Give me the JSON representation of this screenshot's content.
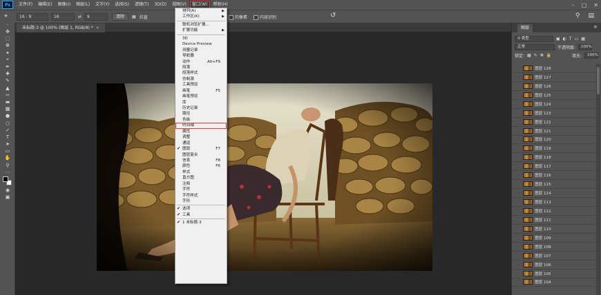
{
  "app": {
    "logo": "Ps"
  },
  "menubar": {
    "items": [
      {
        "label": "文件(F)"
      },
      {
        "label": "编辑(E)"
      },
      {
        "label": "图像(I)"
      },
      {
        "label": "图层(L)"
      },
      {
        "label": "文字(Y)"
      },
      {
        "label": "选择(S)"
      },
      {
        "label": "滤镜(T)"
      },
      {
        "label": "3D(D)"
      },
      {
        "label": "视图(V)"
      },
      {
        "label": "窗口(W)"
      },
      {
        "label": "帮助(H)"
      }
    ],
    "active_index": 9,
    "window_controls": [
      "minimize-icon",
      "restore-icon",
      "close-icon"
    ]
  },
  "options": {
    "ratio_value": "16 : 9",
    "width_value": "16",
    "height_value": "9",
    "clear_label": "清除",
    "straighten_label": "拉直",
    "delete_pixels_label": "的像素",
    "content_aware_label": "内容识别"
  },
  "document": {
    "tab_title": "未标题-3 @ 100% (图层 1, RGB/8) *"
  },
  "window_menu": {
    "items": [
      {
        "label": "排列(A)",
        "submenu": true
      },
      {
        "label": "工作区(K)",
        "submenu": true
      },
      {
        "sep": true
      },
      {
        "label": "联机浏览扩展..."
      },
      {
        "label": "扩展功能",
        "submenu": true
      },
      {
        "sep": true
      },
      {
        "label": "3D"
      },
      {
        "label": "Device Preview"
      },
      {
        "label": "测量记录"
      },
      {
        "label": "导航器"
      },
      {
        "label": "动作",
        "shortcut": "Alt+F9"
      },
      {
        "label": "段落"
      },
      {
        "label": "段落样式"
      },
      {
        "label": "仿制源"
      },
      {
        "label": "工具预设"
      },
      {
        "label": "画笔",
        "shortcut": "F5"
      },
      {
        "label": "画笔预设"
      },
      {
        "label": "库"
      },
      {
        "label": "历史记录"
      },
      {
        "label": "路径"
      },
      {
        "label": "色板"
      },
      {
        "label": "时间轴",
        "highlight": true
      },
      {
        "label": "属性"
      },
      {
        "label": "调整"
      },
      {
        "label": "通道"
      },
      {
        "label": "图层",
        "shortcut": "F7",
        "checked": true
      },
      {
        "label": "图层复合"
      },
      {
        "label": "信息",
        "shortcut": "F8"
      },
      {
        "label": "颜色",
        "shortcut": "F6"
      },
      {
        "label": "样式"
      },
      {
        "label": "直方图"
      },
      {
        "label": "注释"
      },
      {
        "label": "字符"
      },
      {
        "label": "字符样式"
      },
      {
        "label": "字形"
      },
      {
        "sep": true
      },
      {
        "label": "选项",
        "checked": true
      },
      {
        "label": "工具",
        "checked": true
      },
      {
        "sep": true
      },
      {
        "label": "1 未标题-3",
        "checked": true
      }
    ]
  },
  "layers_panel": {
    "tab_label": "图层",
    "kind_label": "类型",
    "blend_mode": "正常",
    "opacity_label": "不透明度:",
    "opacity_value": "100%",
    "lock_label": "锁定:",
    "fill_label": "填充:",
    "fill_value": "100%",
    "layers": [
      "图层 128",
      "图层 127",
      "图层 126",
      "图层 125",
      "图层 124",
      "图层 123",
      "图层 122",
      "图层 121",
      "图层 120",
      "图层 119",
      "图层 118",
      "图层 117",
      "图层 116",
      "图层 115",
      "图层 114",
      "图层 113",
      "图层 112",
      "图层 111",
      "图层 110",
      "图层 109",
      "图层 108",
      "图层 107",
      "图层 106",
      "图层 105",
      "图层 104"
    ]
  }
}
